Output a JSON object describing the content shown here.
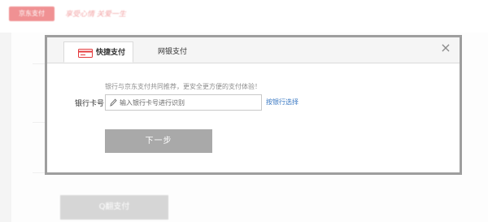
{
  "background": {
    "logo_text": "京东支付",
    "slogan": "享受心情 关爱一生",
    "qpay_button_label": "Q翻支付"
  },
  "modal": {
    "tabs": [
      {
        "label": "快捷支付",
        "icon": "bank-card-icon",
        "active": true
      },
      {
        "label": "网银支付",
        "active": false
      }
    ],
    "close_icon": "close-icon",
    "promo_text": "银行与京东支付共同推荐，更安全更方便的支付体验！",
    "card_field": {
      "label": "银行卡号",
      "placeholder": "输入银行卡号进行识别",
      "value": ""
    },
    "bank_select_link": "按银行选择",
    "next_button_label": "下一步"
  },
  "colors": {
    "brand_red": "#e4393c",
    "link_blue": "#3a78c3",
    "disabled_button": "#a9a9a9",
    "modal_border": "#9e9e9e"
  }
}
